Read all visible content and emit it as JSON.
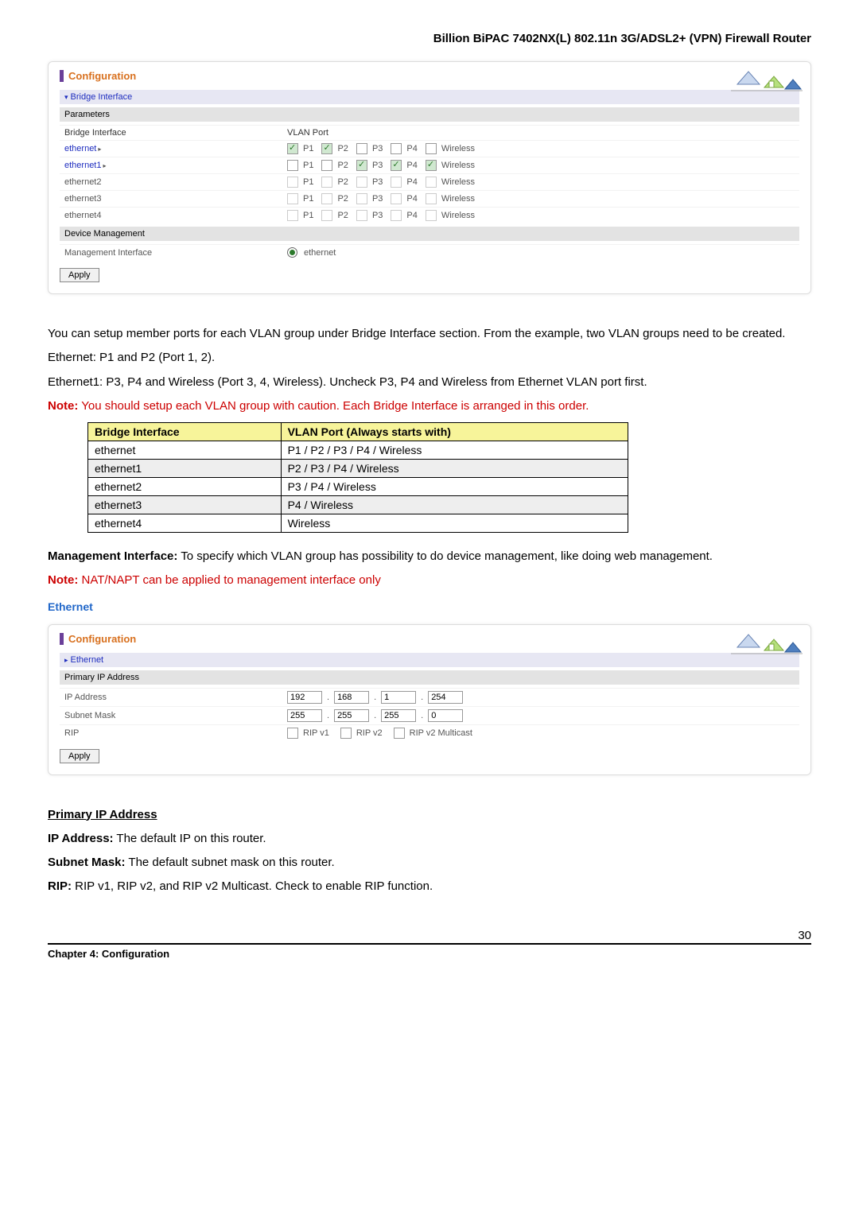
{
  "doc": {
    "header_title": "Billion BiPAC 7402NX(L) 802.11n 3G/ADSL2+ (VPN) Firewall Router",
    "chapter": "Chapter 4: Configuration",
    "page_number": "30"
  },
  "panel1": {
    "title": "Configuration",
    "section_bridge": "Bridge Interface",
    "section_params": "Parameters",
    "hdr_bridge": "Bridge Interface",
    "hdr_vlan": "VLAN Port",
    "rows": [
      {
        "name": "ethernet",
        "link": true,
        "ports": [
          {
            "l": "P1",
            "c": true
          },
          {
            "l": "P2",
            "c": true
          },
          {
            "l": "P3",
            "c": false
          },
          {
            "l": "P4",
            "c": false
          },
          {
            "l": "Wireless",
            "c": false
          }
        ]
      },
      {
        "name": "ethernet1",
        "link": true,
        "ports": [
          {
            "l": "P1",
            "c": false
          },
          {
            "l": "P2",
            "c": false
          },
          {
            "l": "P3",
            "c": true
          },
          {
            "l": "P4",
            "c": true
          },
          {
            "l": "Wireless",
            "c": true
          }
        ]
      },
      {
        "name": "ethernet2",
        "link": false,
        "ports": [
          {
            "l": "P1",
            "c": false
          },
          {
            "l": "P2",
            "c": false
          },
          {
            "l": "P3",
            "c": false
          },
          {
            "l": "P4",
            "c": false
          },
          {
            "l": "Wireless",
            "c": false
          }
        ]
      },
      {
        "name": "ethernet3",
        "link": false,
        "ports": [
          {
            "l": "P1",
            "c": false
          },
          {
            "l": "P2",
            "c": false
          },
          {
            "l": "P3",
            "c": false
          },
          {
            "l": "P4",
            "c": false
          },
          {
            "l": "Wireless",
            "c": false
          }
        ]
      },
      {
        "name": "ethernet4",
        "link": false,
        "ports": [
          {
            "l": "P1",
            "c": false
          },
          {
            "l": "P2",
            "c": false
          },
          {
            "l": "P3",
            "c": false
          },
          {
            "l": "P4",
            "c": false
          },
          {
            "l": "Wireless",
            "c": false
          }
        ]
      }
    ],
    "section_device_mgmt": "Device Management",
    "mgmt_label": "Management Interface",
    "mgmt_value": "ethernet",
    "apply": "Apply"
  },
  "body": {
    "p1": "You can setup member ports for each VLAN group under Bridge Interface section. From the example, two VLAN groups need to be created.",
    "p2": "Ethernet: P1 and P2 (Port 1, 2).",
    "p3": "Ethernet1: P3, P4 and Wireless (Port 3, 4, Wireless). Uncheck P3, P4 and Wireless from Ethernet VLAN port first.",
    "note1_label": "Note:",
    "note1_text": " You should setup each VLAN group with caution. Each Bridge Interface is arranged in this order.",
    "table_h1": "Bridge Interface",
    "table_h2": "VLAN Port (Always starts with)",
    "table_rows": [
      [
        "ethernet",
        "P1 / P2 / P3 / P4 / Wireless"
      ],
      [
        "ethernet1",
        "P2 / P3 / P4 / Wireless"
      ],
      [
        "ethernet2",
        "P3 / P4 / Wireless"
      ],
      [
        "ethernet3",
        "P4 / Wireless"
      ],
      [
        "ethernet4",
        "Wireless"
      ]
    ],
    "mgmt_if_bold": "Management Interface:",
    "mgmt_if_text": " To specify which VLAN group has possibility to do device management, like doing web management.",
    "note2_label": "Note:",
    "note2_text": " NAT/NAPT can be applied to management interface only",
    "eth_heading": "Ethernet"
  },
  "panel2": {
    "title": "Configuration",
    "section_eth": "Ethernet",
    "section_primary": "Primary IP Address",
    "ip_label": "IP Address",
    "ip": [
      "192",
      "168",
      "1",
      "254"
    ],
    "mask_label": "Subnet Mask",
    "mask": [
      "255",
      "255",
      "255",
      "0"
    ],
    "rip_label": "RIP",
    "rip_opts": [
      "RIP v1",
      "RIP v2",
      "RIP v2 Multicast"
    ],
    "apply": "Apply"
  },
  "body2": {
    "primary_heading": "Primary IP Address",
    "ip_bold": "IP Address:",
    "ip_text": " The default IP on this router.",
    "mask_bold": "Subnet Mask:",
    "mask_text": " The default subnet mask on this router.",
    "rip_bold": "RIP:",
    "rip_text": " RIP v1, RIP v2, and RIP v2 Multicast.    Check to enable RIP function."
  }
}
